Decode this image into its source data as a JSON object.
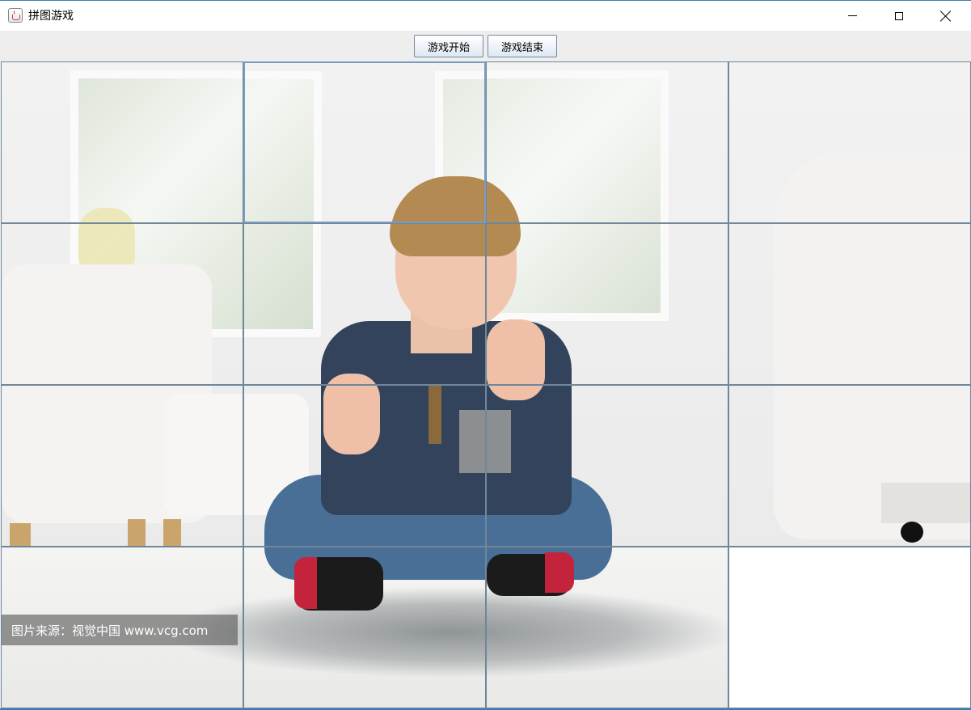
{
  "window": {
    "title": "拼图游戏",
    "icon": "java-cup-icon",
    "controls": [
      "minimize-icon",
      "maximize-icon",
      "close-icon"
    ]
  },
  "toolbar": {
    "start_label": "游戏开始",
    "end_label": "游戏结束"
  },
  "board": {
    "rows": 4,
    "cols": 4,
    "blank_tile": {
      "row": 3,
      "col": 3
    },
    "selected_tile": {
      "row": 0,
      "col": 1
    },
    "image_description_icon": "boy-doing-jigsaw-puzzle-photo"
  },
  "watermark": {
    "text": "图片来源：视觉中国 www.vcg.com"
  },
  "colors": {
    "titlebar_bg": "#ffffff",
    "toolbar_bg": "#eeeeee",
    "grid_line": "#6f8799",
    "window_border": "#3c7fb1"
  }
}
